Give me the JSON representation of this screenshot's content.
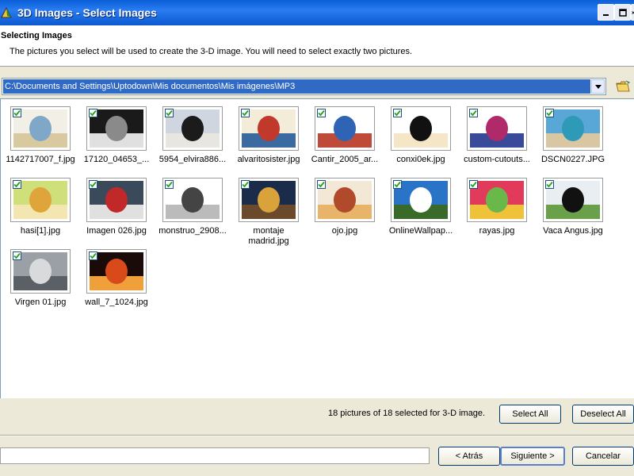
{
  "window": {
    "title": "3D Images - Select Images",
    "controls": [
      "_",
      "□",
      "×"
    ]
  },
  "header": {
    "title": "Selecting Images",
    "subtitle": "The pictures you select will be used to create the 3-D image. You will need to select exactly two pictures."
  },
  "path": {
    "value": "C:\\Documents and Settings\\Uptodown\\Mis documentos\\Mis imágenes\\MP3"
  },
  "thumbnails": [
    {
      "label": "1142717007_f.jpg",
      "checked": true,
      "colors": [
        "#f2f0e6",
        "#7fa8c8",
        "#d8c9a0"
      ]
    },
    {
      "label": "17120_04653_...",
      "checked": true,
      "colors": [
        "#1a1a1a",
        "#8a8a8a",
        "#e0e0e0"
      ]
    },
    {
      "label": "5954_elvira886...",
      "checked": true,
      "colors": [
        "#cfd6df",
        "#1b1b1b",
        "#e8e6e0"
      ]
    },
    {
      "label": "alvaritosister.jpg",
      "checked": true,
      "colors": [
        "#f2ecd8",
        "#c0392b",
        "#3b6aa0"
      ]
    },
    {
      "label": "Cantir_2005_ar...",
      "checked": true,
      "colors": [
        "#ffffff",
        "#2f63b5",
        "#c04a3a"
      ]
    },
    {
      "label": "conxi0ek.jpg",
      "checked": true,
      "colors": [
        "#ffffff",
        "#111111",
        "#f5e6c8"
      ]
    },
    {
      "label": "custom-cutouts...",
      "checked": true,
      "colors": [
        "#ffffff",
        "#b02a6a",
        "#3a4a9a"
      ]
    },
    {
      "label": "DSCN0227.JPG",
      "checked": true,
      "colors": [
        "#58a7d6",
        "#2f9ab8",
        "#d9c7a3"
      ]
    },
    {
      "label": "hasi[1].jpg",
      "checked": true,
      "colors": [
        "#cfe07a",
        "#e0a53a",
        "#f3e6b0"
      ]
    },
    {
      "label": "Imagen 026.jpg",
      "checked": true,
      "colors": [
        "#3a4a5a",
        "#c0282a",
        "#e0e0e0"
      ]
    },
    {
      "label": "monstruo_2908...",
      "checked": true,
      "colors": [
        "#ffffff",
        "#444444",
        "#bbbbbb"
      ]
    },
    {
      "label": "montaje\nmadrid.jpg",
      "checked": true,
      "colors": [
        "#1b2b4a",
        "#d9a23a",
        "#6a4a2a"
      ]
    },
    {
      "label": "ojo.jpg",
      "checked": true,
      "colors": [
        "#f3e7d6",
        "#b04a2a",
        "#e8b46a"
      ]
    },
    {
      "label": "OnlineWallpap...",
      "checked": true,
      "colors": [
        "#2a74c8",
        "#ffffff",
        "#3a6a2a"
      ]
    },
    {
      "label": "rayas.jpg",
      "checked": true,
      "colors": [
        "#e23a5a",
        "#6ab84a",
        "#f0c23a"
      ]
    },
    {
      "label": "Vaca Angus.jpg",
      "checked": true,
      "colors": [
        "#e9eef2",
        "#111111",
        "#6aa04a"
      ]
    },
    {
      "label": "Virgen 01.jpg",
      "checked": true,
      "colors": [
        "#9aa0a6",
        "#d8dadc",
        "#5a6066"
      ]
    },
    {
      "label": "wall_7_1024.jpg",
      "checked": true,
      "colors": [
        "#1a0a08",
        "#d84a1a",
        "#f0a03a"
      ]
    }
  ],
  "footer": {
    "status": "18 pictures of 18 selected for 3-D image.",
    "select_all": "Select All",
    "deselect_all": "Deselect All",
    "back": "< Atrás",
    "next": "Siguiente >",
    "cancel": "Cancelar"
  },
  "accent_color": "#316ac5"
}
